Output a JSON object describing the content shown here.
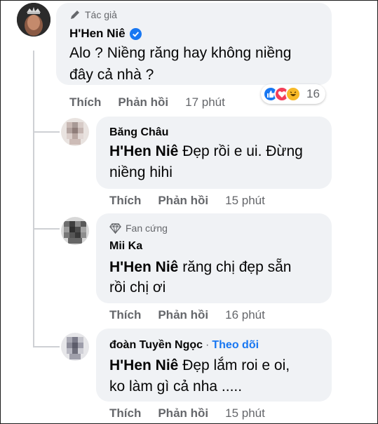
{
  "main_comment": {
    "badge": "Tác giả",
    "author": "H'Hen Niê",
    "text": "Alo ? Niềng răng hay không niềng đây cả nhà ?",
    "text_line1": "Alo ? Niềng răng hay không niềng",
    "text_line2": "đây cả nhà ?",
    "like": "Thích",
    "reply": "Phản hồi",
    "time": "17 phút",
    "reaction_count": "16",
    "reactions": [
      "like-icon",
      "love-icon",
      "haha-icon"
    ]
  },
  "replies": [
    {
      "author": "Băng Châu",
      "mention": "H'Hen Niê",
      "line1": " Đẹp rồi e ui. Đừng",
      "line2": "niềng hihi",
      "like": "Thích",
      "reply": "Phản hồi",
      "time": "15 phút"
    },
    {
      "badge": "Fan cứng",
      "author": "Mii Ka",
      "mention": "H'Hen Niê",
      "line1": " răng chị đẹp sẵn",
      "line2": "rồi chị ơi",
      "like": "Thích",
      "reply": "Phản hồi",
      "time": "16 phút"
    },
    {
      "author": "đoàn Tuyền Ngọc",
      "separator": "·",
      "follow": "Theo dõi",
      "mention": "H'Hen Niê",
      "line1": " Đẹp lắm roi e oi,",
      "line2": "ko làm gì cả nha .....",
      "like": "Thích",
      "reply": "Phản hồi",
      "time": "15 phút"
    }
  ],
  "colors": {
    "bubble": "#f0f2f5",
    "secondary_text": "#65676b",
    "link": "#1877f2",
    "verified": "#1877f2"
  }
}
